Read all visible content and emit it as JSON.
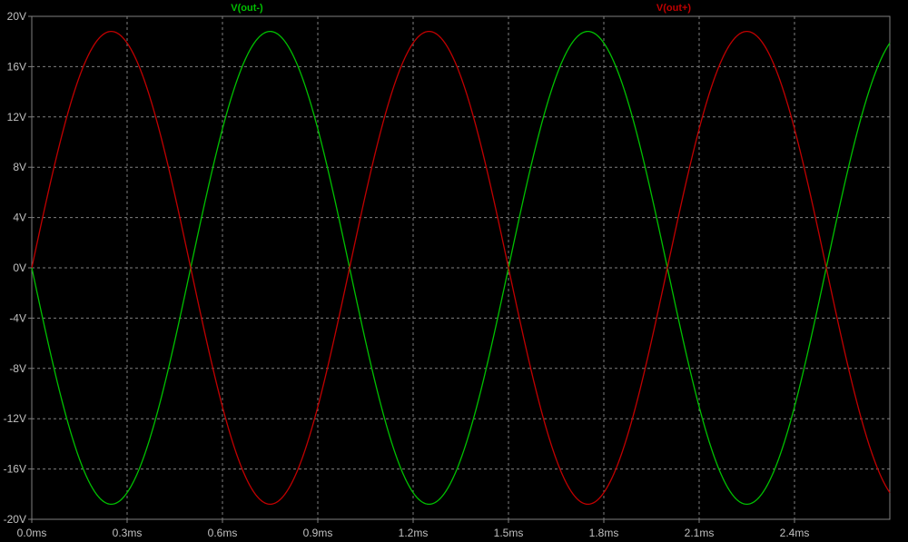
{
  "chart_data": {
    "type": "line",
    "title": "",
    "xlabel": "",
    "ylabel": "",
    "xlim": [
      0,
      2.7
    ],
    "ylim": [
      -20,
      20
    ],
    "x_ticks": [
      0,
      0.3,
      0.6,
      0.9,
      1.2,
      1.5,
      1.8,
      2.1,
      2.4
    ],
    "x_tick_labels": [
      "0.0ms",
      "0.3ms",
      "0.6ms",
      "0.9ms",
      "1.2ms",
      "1.5ms",
      "1.8ms",
      "2.1ms",
      "2.4ms"
    ],
    "y_ticks": [
      20,
      16,
      12,
      8,
      4,
      0,
      -4,
      -8,
      -12,
      -16,
      -20
    ],
    "y_tick_labels": [
      "20V",
      "16V",
      "12V",
      "8V",
      "4V",
      "0V",
      "-4V",
      "-8V",
      "-12V",
      "-16V",
      "-20V"
    ],
    "grid": true,
    "legend_placement": "top",
    "series": [
      {
        "name": "V(out-)",
        "color": "#00c000",
        "amplitude": 18.8,
        "period_ms": 1.0,
        "phase_sign": -1
      },
      {
        "name": "V(out+)",
        "color": "#c00000",
        "amplitude": 18.8,
        "period_ms": 1.0,
        "phase_sign": 1
      }
    ],
    "background": "#000000",
    "grid_color": "#808080",
    "axis_text_color": "#c0c0c0"
  }
}
